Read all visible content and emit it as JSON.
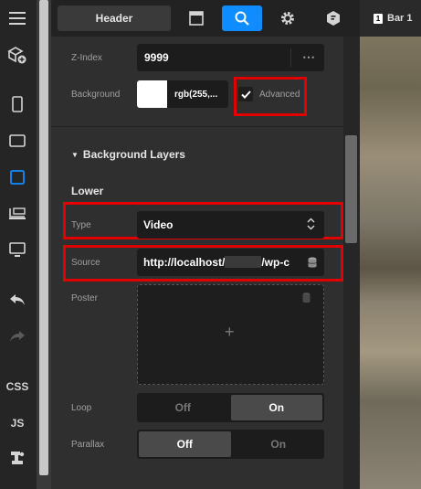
{
  "topbar": {
    "header_label": "Header",
    "canvas_tab_badge": "1",
    "canvas_tab_label": "Bar 1"
  },
  "rail": {
    "css_label": "CSS",
    "js_label": "JS"
  },
  "properties": {
    "zindex": {
      "label": "Z-Index",
      "value": "9999"
    },
    "background": {
      "label": "Background",
      "value": "rgb(255,...",
      "advanced_label": "Advanced",
      "advanced_checked": true
    },
    "section_title": "Background Layers",
    "lower_title": "Lower",
    "type": {
      "label": "Type",
      "value": "Video"
    },
    "source": {
      "label": "Source",
      "value_prefix": "http://localhost/",
      "value_suffix": "/wp-c"
    },
    "poster": {
      "label": "Poster",
      "add_symbol": "+"
    },
    "loop": {
      "label": "Loop",
      "off_label": "Off",
      "on_label": "On",
      "selected": "On"
    },
    "parallax": {
      "label": "Parallax",
      "off_label": "Off",
      "on_label": "On",
      "selected": "Off"
    }
  },
  "colors": {
    "accent": "#0f8cff",
    "highlight": "#e00000"
  }
}
